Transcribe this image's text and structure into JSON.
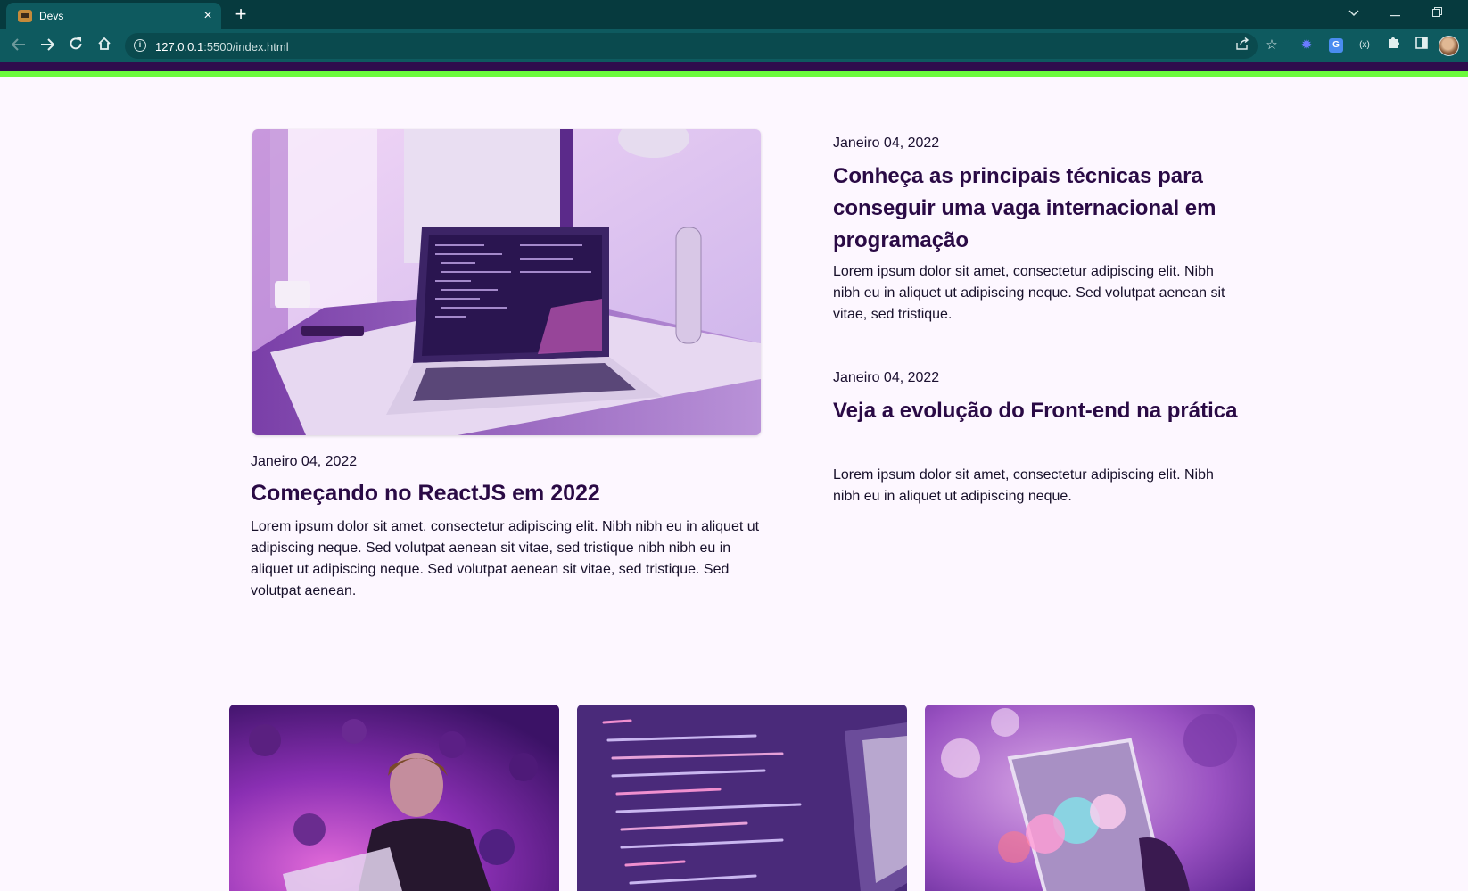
{
  "browser": {
    "tab_title": "Devs",
    "url_host": "127.0.0.1",
    "url_rest": ":5500/index.html",
    "tab_close_glyph": "×",
    "new_tab_glyph": "+",
    "icons": [
      "back-icon",
      "forward-icon",
      "reload-icon",
      "home-icon",
      "site-info-icon",
      "share-icon",
      "bookmark-star-icon",
      "extension-icon",
      "side-panel-icon",
      "profile-avatar"
    ]
  },
  "colors": {
    "header_purple": "#2f0d4d",
    "header_green": "#6bfa3c",
    "title_color": "#2a0a45",
    "page_bg": "#fdf7ff"
  },
  "posts": {
    "main": {
      "date": "Janeiro 04, 2022",
      "title": "Começando no ReactJS em 2022",
      "excerpt": "Lorem ipsum dolor sit amet, consectetur adipiscing elit. Nibh nibh eu in aliquet ut adipiscing neque. Sed volutpat aenean sit vitae, sed tristique nibh nibh eu in aliquet ut adipiscing neque. Sed volutpat aenean sit vitae, sed tristique. Sed volutpat aenean."
    },
    "side": [
      {
        "date": "Janeiro 04, 2022",
        "title": "Conheça as principais técnicas para conseguir uma vaga internacional em programação",
        "excerpt": "Lorem ipsum dolor sit amet, consectetur adipiscing elit. Nibh nibh eu in aliquet ut adipiscing neque. Sed volutpat aenean sit vitae, sed tristique."
      },
      {
        "date": "Janeiro 04, 2022",
        "title": "Veja a evolução do Front-end na prática",
        "excerpt": "Lorem ipsum dolor sit amet, consectetur adipiscing elit. Nibh nibh eu in aliquet ut adipiscing neque."
      }
    ]
  }
}
